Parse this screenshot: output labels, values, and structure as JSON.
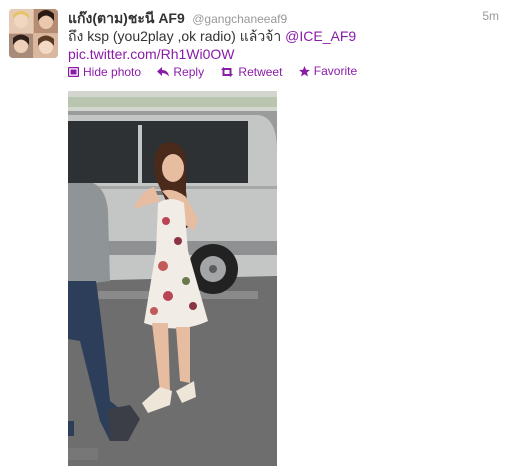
{
  "tweet": {
    "fullname": "แก๊ง(ตาม)ชะนี AF9",
    "username": "@gangchaneeaf9",
    "time": "5m",
    "text_main": "ถึง ksp (you2play ,ok radio) แล้วจ้า ",
    "mention": "@ICE_AF9",
    "photo_link": "pic.twitter.com/Rh1Wi0OW"
  },
  "actions": [
    {
      "label": "Hide photo",
      "icon": "photo-icon"
    },
    {
      "label": "Reply",
      "icon": "reply-icon"
    },
    {
      "label": "Retweet",
      "icon": "retweet-icon"
    },
    {
      "label": "Favorite",
      "icon": "star-icon"
    }
  ],
  "colors": {
    "link": "#8a1ca8",
    "secondary_text": "#999999",
    "primary_text": "#333333"
  }
}
